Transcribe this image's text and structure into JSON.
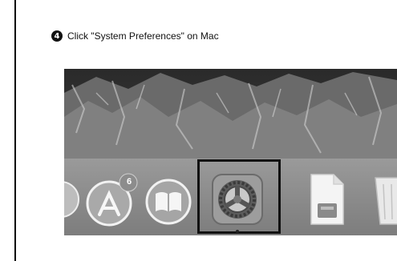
{
  "instruction": {
    "step_number": "4",
    "text": "Click \"System Preferences\" on Mac"
  },
  "dock": {
    "items": [
      {
        "name": "partial-app-icon"
      },
      {
        "name": "app-store-icon",
        "badge": "6"
      },
      {
        "name": "ibooks-icon"
      },
      {
        "name": "system-preferences-icon",
        "highlighted": true
      },
      {
        "name": "preview-file-icon"
      },
      {
        "name": "trash-icon"
      }
    ]
  },
  "colors": {
    "highlight": "#111111",
    "badge": "#8c8c8c"
  }
}
